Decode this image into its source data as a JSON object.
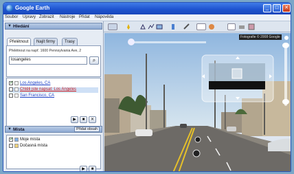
{
  "window": {
    "title": "Google Earth"
  },
  "menu": [
    "Soubor",
    "Úpravy",
    "Zobrazit",
    "Nástroje",
    "Přidat",
    "Nápověda"
  ],
  "search_panel": {
    "header": "Hledání",
    "tabs": [
      "Přelétnout",
      "Najít firmy",
      "Trasy"
    ],
    "prompt": "Přelétnout na např. 1600 Pennsylvania Ave, 2",
    "input_value": "losangeles",
    "results": [
      {
        "label": "Los Angeles, CA",
        "checked": true,
        "style": "link"
      },
      {
        "label": "Chtěli jste napsat: Los Angeles",
        "checked": false,
        "style": "red"
      },
      {
        "label": "San Francisco, CA",
        "checked": false,
        "style": "link"
      }
    ]
  },
  "places_panel": {
    "header": "Místa",
    "action": "Přidat obsah",
    "items": [
      {
        "label": "Moje místa",
        "checked": true
      },
      {
        "label": "Dočasná místa",
        "checked": false
      }
    ]
  },
  "view": {
    "attribution": "Fotografie © 2008 Google"
  },
  "colors": {
    "title_bar": "#1f55d0",
    "sky": "#a9c7e6",
    "road": "#6d6a66"
  }
}
